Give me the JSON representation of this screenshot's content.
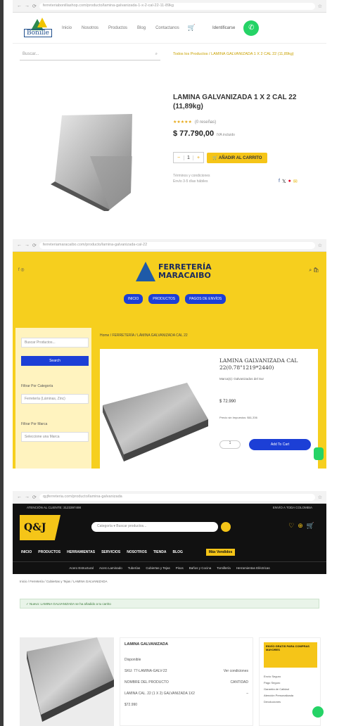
{
  "panel1": {
    "url": "ferreteriabonillashop.com/producto/lamina-galvanizada-1-x-2-cal-22-11-89kg",
    "logo": "Bonille",
    "menu": [
      "Inicio",
      "Nosotros",
      "Productos",
      "Blog",
      "Contactanos"
    ],
    "account": "Identificarse",
    "search_placeholder": "Buscar...",
    "breadcrumb": "Todos los Productos / LAMINA GALVANIZADA 1 X 2 CAL 22 (11,89kg)",
    "title": "LAMINA GALVANIZADA 1 X 2 CAL 22 (11,89kg)",
    "rating_text": "(0 reseñas)",
    "price": "$ 77.790,00",
    "price_note": "IVA incluido",
    "qty_minus": "−",
    "qty_value": "1",
    "qty_plus": "+",
    "add_to_cart": "AÑADIR AL CARRITO",
    "meta_line1": "Términos y condiciones",
    "meta_line2": "Envío 3-5 días hábiles",
    "share_icons": "f  𝕏  ✿  ✉"
  },
  "panel2": {
    "url": "ferreteriamaracaibo.com/producto/lamina-galvanizada-cal-22",
    "logo_line1": "FERRETERÍA",
    "logo_line2": "MARACAIBO",
    "nav_buttons": [
      "INICIO",
      "PRODUCTOS",
      "PAGOS DE ENVÍOS"
    ],
    "search_placeholder": "Buscar Productos...",
    "search_button": "Search",
    "filter_category_label": "Filtrar Por Categoría",
    "filter_category_value": "Ferretería (Láminas, Zinc)",
    "filter_brand_label": "Filtrar Por Marca",
    "filter_brand_value": "Seleccione una Marca",
    "breadcrumb": "Home / FERRETERÍA / LÁMINA GALVANIZADA CAL 22",
    "title": "LAMINA GALVANIZADA CAL 22(0.78\"1219*2440)",
    "brand": "Marca(s): Galvanizados del Sur",
    "price": "$ 72.990",
    "price_note": "Precio sin Impuestos: $61,336",
    "qty": "1",
    "add_button": "Add To Cart"
  },
  "panel3": {
    "url": "qyjferreteria.com/producto/lamina-galvanizada",
    "top_left": "ATENCIÓN AL CLIENTE: 3123397498",
    "top_right": "ENVÍO A TODA COLOMBIA",
    "logo": "Q&J",
    "search_category": "Categoría",
    "search_placeholder": "Buscar productos...",
    "menu": [
      "INICIO",
      "PRODUCTOS",
      "HERRAMIENTAS",
      "SERVICIOS",
      "NOSOTROS",
      "TIENDA",
      "BLOG"
    ],
    "menu_select": "Más Vendidos",
    "sub_menu": [
      "Acero Estructural",
      "Acero Laminado",
      "Tuberías",
      "Cubiertas y Tejas",
      "Pisos",
      "Baños y Cocina",
      "Tornillería",
      "Herramientas Eléctricas"
    ],
    "breadcrumb": "Inicio / Ferretería / Cubiertas y Tejas / LAMINA GALVANIZADA",
    "notice": "✓ Nuevo: LAMINA GALVANIZADA se ha añadido a tu carrito",
    "product_title": "LAMINA GALVANIZADA",
    "stock": "Disponible",
    "sku_label": "SKU: 77-LAMINA-GALV-22",
    "sku_value": "Ver condiciones",
    "col_product": "NOMBRE DEL PRODUCTO",
    "col_qty": "CANTIDAD",
    "row_product": "LAMINA CAL. 22 (1 X 2) GALVANIZADA 1X2",
    "row_price": "$72.990",
    "banner": "ENVÍO GRATIS PARA COMPRAS MAYORES",
    "aside_items": [
      "Envío Seguro",
      "Pago Seguro",
      "Garantía de Calidad",
      "Atención Personalizada",
      "Devoluciones"
    ]
  }
}
